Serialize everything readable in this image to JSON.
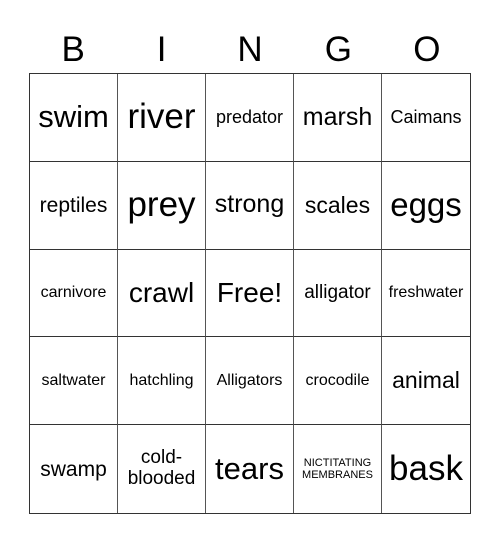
{
  "header": [
    "B",
    "I",
    "N",
    "G",
    "O"
  ],
  "cells": [
    "swim",
    "river",
    "predator",
    "marsh",
    "Caimans",
    "reptiles",
    "prey",
    "strong",
    "scales",
    "eggs",
    "carnivore",
    "crawl",
    "Free!",
    "alligator",
    "freshwater",
    "saltwater",
    "hatchling",
    "Alligators",
    "crocodile",
    "animal",
    "swamp",
    "cold-blooded",
    "tears",
    "NICTITATING MEMBRANES",
    "bask"
  ],
  "free_space": "Free!"
}
